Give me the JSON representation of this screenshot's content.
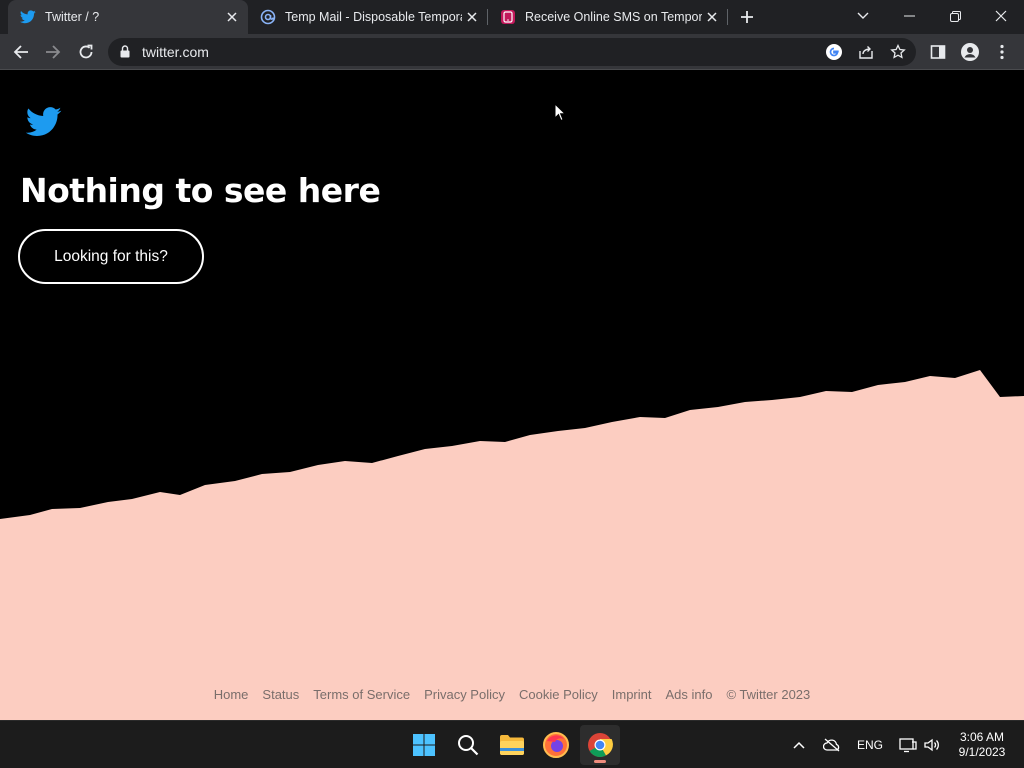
{
  "browser": {
    "tabs": [
      {
        "title": "Twitter / ?",
        "favicon": "twitter-icon",
        "active": true
      },
      {
        "title": "Temp Mail - Disposable Temporar",
        "favicon": "at-sign-icon",
        "active": false
      },
      {
        "title": "Receive Online SMS on Temporar",
        "favicon": "sms-site-icon",
        "active": false
      }
    ],
    "url": "twitter.com",
    "colors": {
      "tabstrip": "#202124",
      "toolbar": "#35363a",
      "omnibox": "#202124"
    }
  },
  "page": {
    "heading": "Nothing to see here",
    "button_label": "Looking for this?",
    "footer_links": [
      "Home",
      "Status",
      "Terms of Service",
      "Privacy Policy",
      "Cookie Policy",
      "Imprint",
      "Ads info",
      "© Twitter 2023"
    ],
    "colors": {
      "background": "#000000",
      "accent": "#1d9bf0",
      "peach": "#fccdc1"
    }
  },
  "taskbar": {
    "apps": [
      "windows-start-icon",
      "search-icon",
      "file-explorer-icon",
      "firefox-icon",
      "chrome-icon"
    ],
    "language": "ENG",
    "time": "3:06 AM",
    "date": "9/1/2023"
  }
}
